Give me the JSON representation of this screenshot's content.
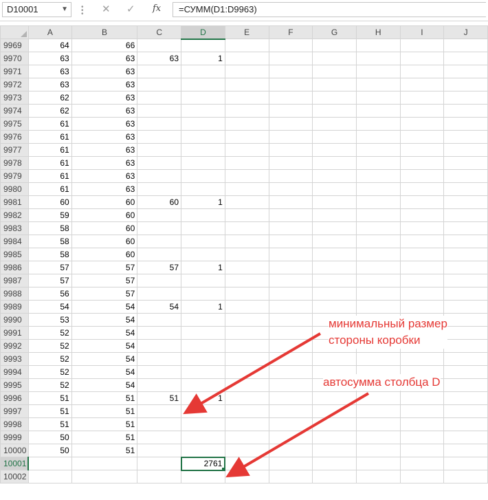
{
  "formula_bar": {
    "name_box": "D10001",
    "formula": "=СУММ(D1:D9963)",
    "fx_label": "fx"
  },
  "columns": [
    "A",
    "B",
    "C",
    "D",
    "E",
    "F",
    "G",
    "H",
    "I",
    "J"
  ],
  "active_column": "D",
  "rows": [
    {
      "n": "9969",
      "a": "64",
      "b": "66",
      "c": "",
      "d": ""
    },
    {
      "n": "9970",
      "a": "63",
      "b": "63",
      "c": "63",
      "d": "1"
    },
    {
      "n": "9971",
      "a": "63",
      "b": "63",
      "c": "",
      "d": ""
    },
    {
      "n": "9972",
      "a": "63",
      "b": "63",
      "c": "",
      "d": ""
    },
    {
      "n": "9973",
      "a": "62",
      "b": "63",
      "c": "",
      "d": ""
    },
    {
      "n": "9974",
      "a": "62",
      "b": "63",
      "c": "",
      "d": ""
    },
    {
      "n": "9975",
      "a": "61",
      "b": "63",
      "c": "",
      "d": ""
    },
    {
      "n": "9976",
      "a": "61",
      "b": "63",
      "c": "",
      "d": ""
    },
    {
      "n": "9977",
      "a": "61",
      "b": "63",
      "c": "",
      "d": ""
    },
    {
      "n": "9978",
      "a": "61",
      "b": "63",
      "c": "",
      "d": ""
    },
    {
      "n": "9979",
      "a": "61",
      "b": "63",
      "c": "",
      "d": ""
    },
    {
      "n": "9980",
      "a": "61",
      "b": "63",
      "c": "",
      "d": ""
    },
    {
      "n": "9981",
      "a": "60",
      "b": "60",
      "c": "60",
      "d": "1"
    },
    {
      "n": "9982",
      "a": "59",
      "b": "60",
      "c": "",
      "d": ""
    },
    {
      "n": "9983",
      "a": "58",
      "b": "60",
      "c": "",
      "d": ""
    },
    {
      "n": "9984",
      "a": "58",
      "b": "60",
      "c": "",
      "d": ""
    },
    {
      "n": "9985",
      "a": "58",
      "b": "60",
      "c": "",
      "d": ""
    },
    {
      "n": "9986",
      "a": "57",
      "b": "57",
      "c": "57",
      "d": "1"
    },
    {
      "n": "9987",
      "a": "57",
      "b": "57",
      "c": "",
      "d": ""
    },
    {
      "n": "9988",
      "a": "56",
      "b": "57",
      "c": "",
      "d": ""
    },
    {
      "n": "9989",
      "a": "54",
      "b": "54",
      "c": "54",
      "d": "1"
    },
    {
      "n": "9990",
      "a": "53",
      "b": "54",
      "c": "",
      "d": ""
    },
    {
      "n": "9991",
      "a": "52",
      "b": "54",
      "c": "",
      "d": ""
    },
    {
      "n": "9992",
      "a": "52",
      "b": "54",
      "c": "",
      "d": ""
    },
    {
      "n": "9993",
      "a": "52",
      "b": "54",
      "c": "",
      "d": ""
    },
    {
      "n": "9994",
      "a": "52",
      "b": "54",
      "c": "",
      "d": ""
    },
    {
      "n": "9995",
      "a": "52",
      "b": "54",
      "c": "",
      "d": ""
    },
    {
      "n": "9996",
      "a": "51",
      "b": "51",
      "c": "51",
      "d": "1"
    },
    {
      "n": "9997",
      "a": "51",
      "b": "51",
      "c": "",
      "d": ""
    },
    {
      "n": "9998",
      "a": "51",
      "b": "51",
      "c": "",
      "d": ""
    },
    {
      "n": "9999",
      "a": "50",
      "b": "51",
      "c": "",
      "d": ""
    },
    {
      "n": "10000",
      "a": "50",
      "b": "51",
      "c": "",
      "d": ""
    },
    {
      "n": "10001",
      "a": "",
      "b": "",
      "c": "",
      "d": "2761",
      "selected": true
    },
    {
      "n": "10002",
      "a": "",
      "b": "",
      "c": "",
      "d": ""
    }
  ],
  "annotations": {
    "min_side": "минимальный размер стороны коробки",
    "min_side_line1": "минимальный размер",
    "min_side_line2": "стороны коробки",
    "autosum": "автосумма столбца D"
  },
  "colors": {
    "accent": "#217346",
    "annotation": "#e53935",
    "header_bg": "#e6e6e6",
    "gridline": "#d4d4d4"
  }
}
